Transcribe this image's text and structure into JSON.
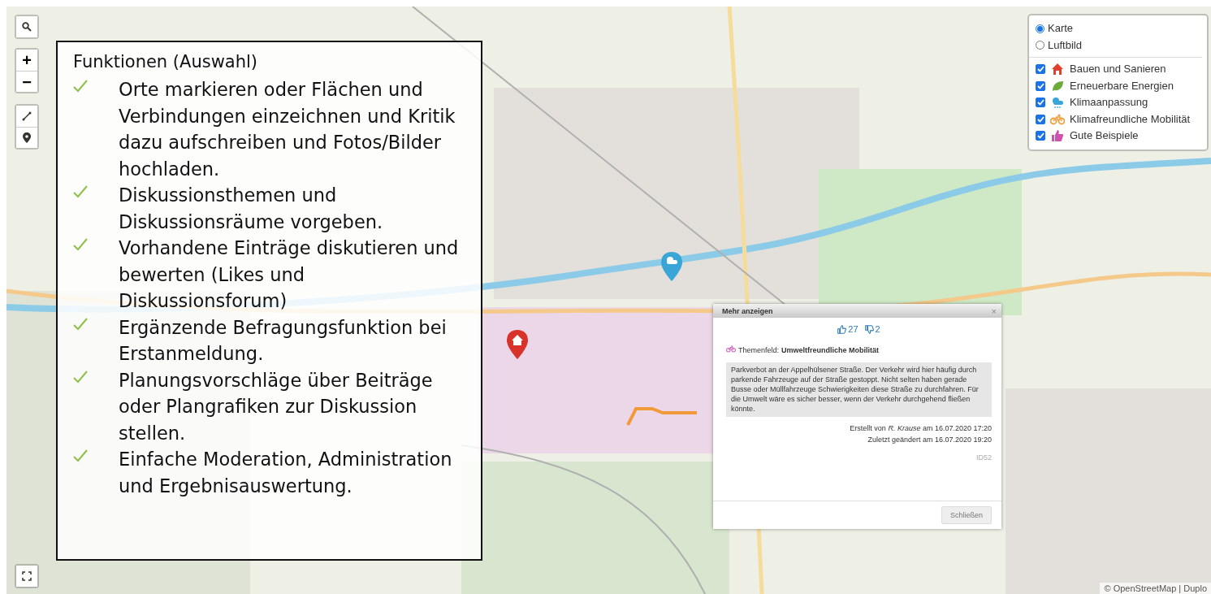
{
  "map_controls": {
    "zoom_in": "+",
    "zoom_out": "−"
  },
  "features": {
    "title": "Funktionen (Auswahl)",
    "items": [
      "Orte markieren oder Flächen und Verbindungen einzeichnen und Kritik dazu aufschreiben und Fotos/Bilder hochladen.",
      "Diskussionsthemen und Diskussionsräume vorgeben.",
      "Vorhandene Einträge diskutieren und bewerten (Likes und Diskussionsforum)",
      "Ergänzende Befragungsfunktion bei Erstanmeldung.",
      "Planungsvorschläge über Beiträge oder Plangrafiken zur Diskussion stellen.",
      "Einfache Moderation, Administration und Ergebnisauswertung."
    ]
  },
  "layers": {
    "base": [
      {
        "label": "Karte",
        "selected": true
      },
      {
        "label": "Luftbild",
        "selected": false
      }
    ],
    "overlays": [
      {
        "label": "Bauen und Sanieren",
        "checked": true,
        "kind": "house",
        "color": "#e0412f"
      },
      {
        "label": "Erneuerbare Energien",
        "checked": true,
        "kind": "leaf",
        "color": "#6aab3a"
      },
      {
        "label": "Klimaanpassung",
        "checked": true,
        "kind": "weather",
        "color": "#3aa6d8"
      },
      {
        "label": "Klimafreundliche Mobilität",
        "checked": true,
        "kind": "bike",
        "color": "#f0a040"
      },
      {
        "label": "Gute Beispiele",
        "checked": true,
        "kind": "thumb",
        "color": "#d050b0"
      }
    ]
  },
  "popup": {
    "title": "Mehr anzeigen",
    "close": "×",
    "likes": "27",
    "dislikes": "2",
    "topic_label": "Themenfeld:",
    "topic": "Umweltfreundliche Mobilität",
    "body": "Parkverbot an der Appelhülsener Straße. Der Verkehr wird hier häufig durch parkende Fahrzeuge auf der Straße gestoppt. Nicht selten haben gerade Busse oder Müllfahrzeuge Schwierigkeiten diese Straße zu durchfahren. Für die Umwelt wäre es sicher besser, wenn der Verkehr durchgehend fließen könnte.",
    "created": "Erstellt von *R. Krause* am 16.07.2020 17:20",
    "modified": "Zuletzt geändert am 16.07.2020 19:20",
    "id": "ID52",
    "button": "Schließen"
  },
  "attribution": "© OpenStreetMap | Duplo"
}
